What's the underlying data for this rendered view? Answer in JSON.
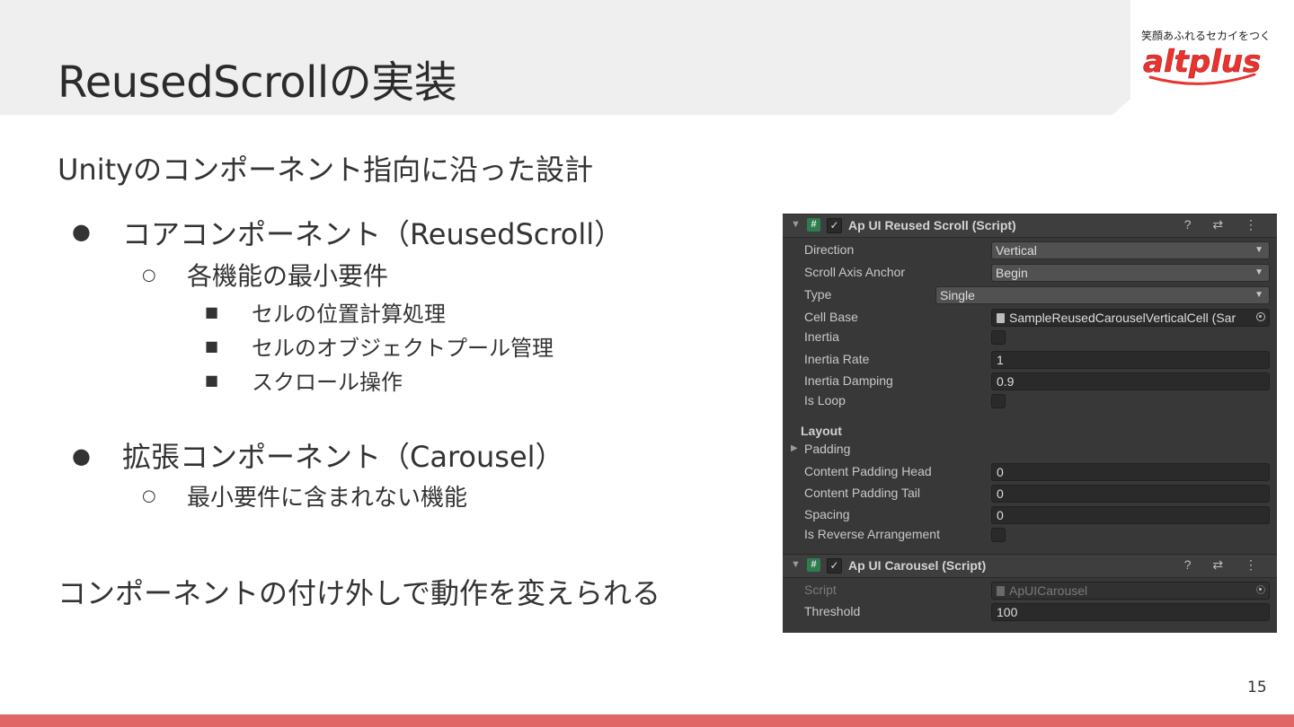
{
  "slide": {
    "title": "ReusedScrollの実装",
    "subtitle": "Unityのコンポーネント指向に沿った設計",
    "core_component": "コアコンポーネント（ReusedScroll）",
    "core_sub": "各機能の最小要件",
    "core_items": [
      "セルの位置計算処理",
      "セルのオブジェクトプール管理",
      "スクロール操作"
    ],
    "ext_component": "拡張コンポーネント（Carousel）",
    "ext_sub": "最小要件に含まれない機能",
    "conclusion": "コンポーネントの付け外しで動作を変えられる",
    "page_number": "15",
    "bullets": {
      "level1": "●",
      "level2": "○",
      "level3": "■"
    }
  },
  "logo": {
    "tagline": "笑顔あふれるセカイをつくる",
    "brand": "altplus",
    "color": "#e8342e"
  },
  "inspector": {
    "reused_scroll": {
      "name": "Ap UI Reused Scroll (Script)",
      "header_icons": "? ⇄ ⋮",
      "direction_label": "Direction",
      "direction_value": "Vertical",
      "anchor_label": "Scroll Axis Anchor",
      "anchor_value": "Begin",
      "type_label": "Type",
      "type_value": "Single",
      "cell_base_label": "Cell Base",
      "cell_base_value": "SampleReusedCarouselVerticalCell (Sar",
      "inertia_label": "Inertia",
      "inertia_rate_label": "Inertia Rate",
      "inertia_rate_value": "1",
      "inertia_damping_label": "Inertia Damping",
      "inertia_damping_value": "0.9",
      "is_loop_label": "Is Loop",
      "layout_label": "Layout",
      "padding_label": "Padding",
      "pad_head_label": "Content Padding Head",
      "pad_head_value": "0",
      "pad_tail_label": "Content Padding Tail",
      "pad_tail_value": "0",
      "spacing_label": "Spacing",
      "spacing_value": "0",
      "reverse_label": "Is Reverse Arrangement"
    },
    "carousel": {
      "name": "Ap UI Carousel (Script)",
      "header_icons": "? ⇄ ⋮",
      "script_label": "Script",
      "script_value": "ApUICarousel",
      "threshold_label": "Threshold",
      "threshold_value": "100"
    }
  }
}
